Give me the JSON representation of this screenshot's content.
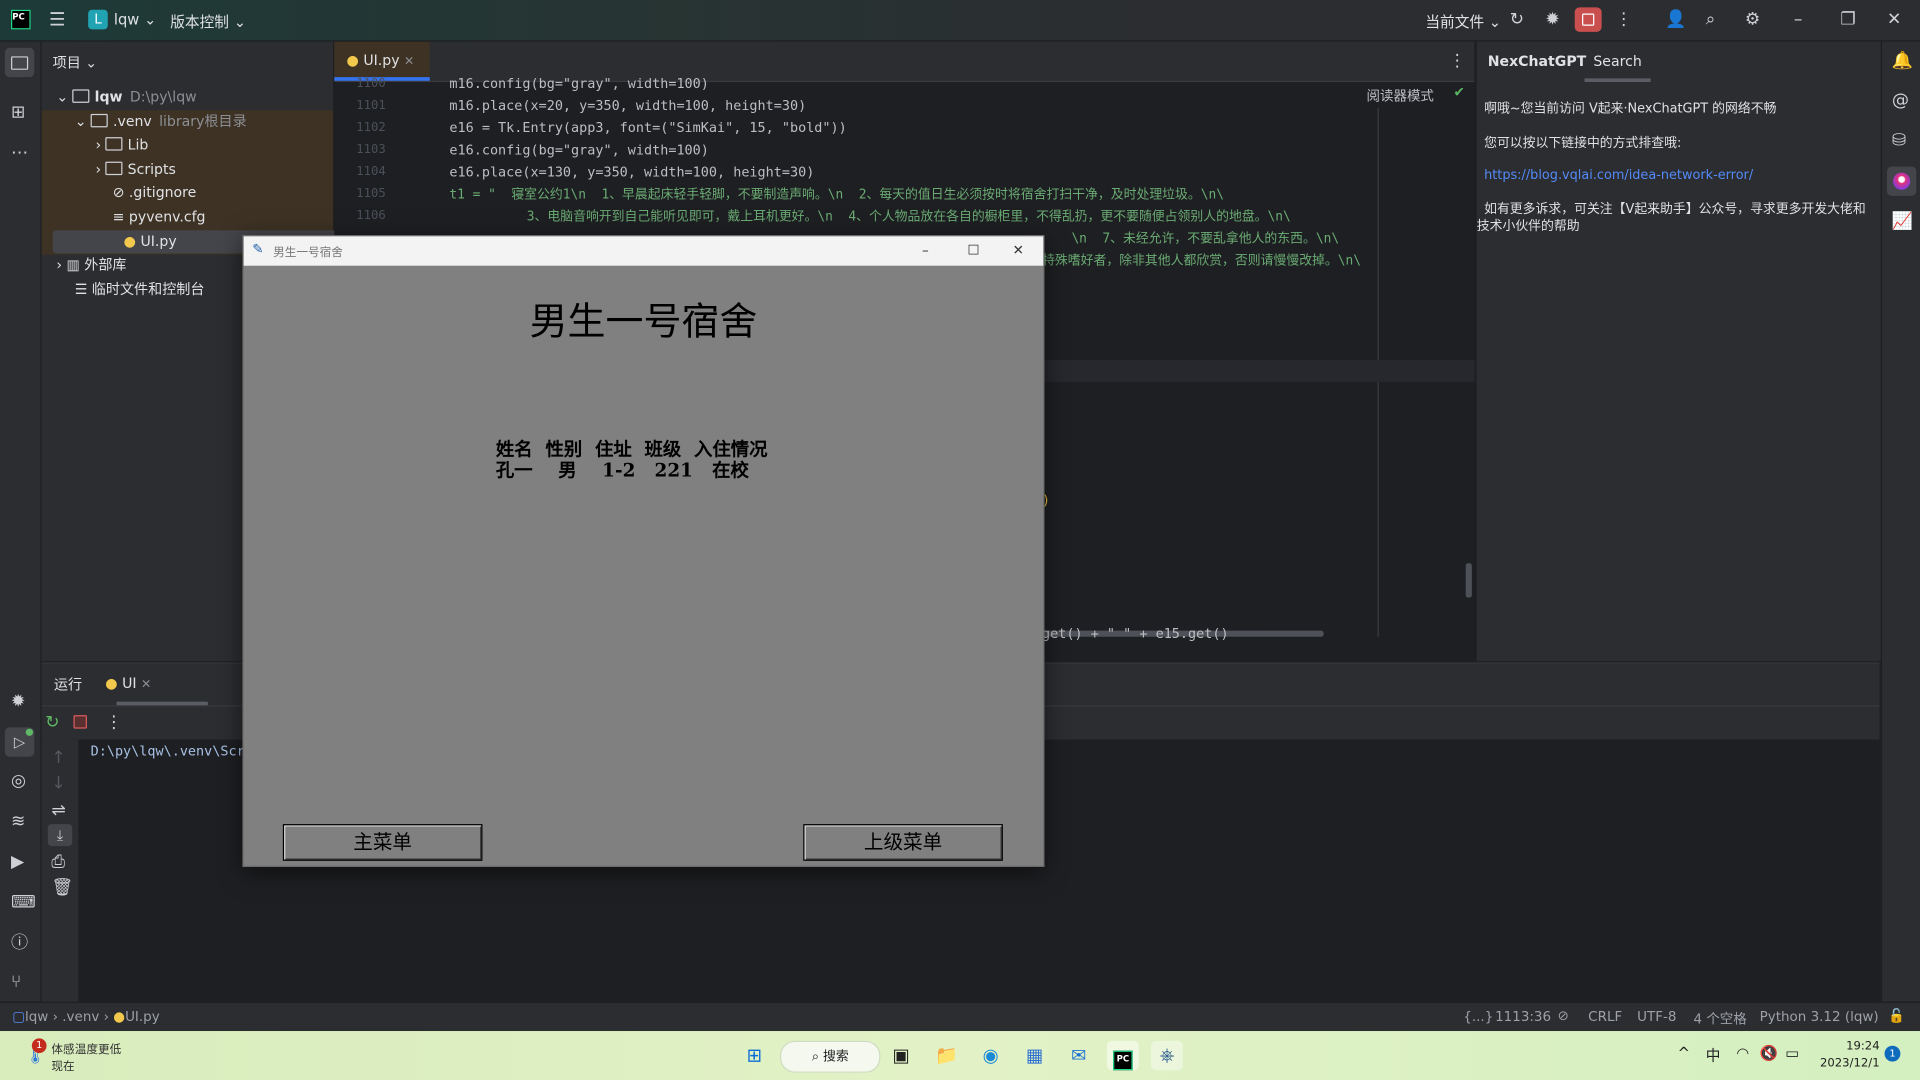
{
  "titlebar": {
    "project_badge": "L",
    "project": "lqw",
    "vcs": "版本控制",
    "run_config": "当前文件"
  },
  "project_panel": {
    "title": "项目",
    "tree": [
      {
        "name": "lqw",
        "hint": "D:\\py\\lqw"
      },
      {
        "name": ".venv",
        "hint": "library根目录"
      },
      {
        "name": "Lib"
      },
      {
        "name": "Scripts"
      },
      {
        "name": ".gitignore"
      },
      {
        "name": "pyvenv.cfg"
      },
      {
        "name": "UI.py"
      },
      {
        "name": "外部库"
      },
      {
        "name": "临时文件和控制台"
      }
    ]
  },
  "editor": {
    "tab": "UI.py",
    "reader_mode": "阅读器模式",
    "lines": [
      {
        "no": "1100",
        "code": "m16.config(bg=\"gray\", width=100)"
      },
      {
        "no": "1101",
        "code": "m16.place(x=20, y=350, width=100, height=30)"
      },
      {
        "no": "1102",
        "code": "e16 = Tk.Entry(app3, font=(\"SimKai\", 15, \"bold\"))"
      },
      {
        "no": "1103",
        "code": "e16.config(bg=\"gray\", width=100)"
      },
      {
        "no": "1104",
        "code": "e16.place(x=130, y=350, width=100, height=30)"
      },
      {
        "no": "1105",
        "code": "t1 = \"  寝室公约1\\n  1、早晨起床轻手轻脚，不要制造声响。\\n  2、每天的值日生必须按时将宿舍打扫干净，及时处理垃圾。\\n\\"
      },
      {
        "no": "1106",
        "code": "          3、电脑音响开到自己能听见即可，戴上耳机更好。\\n  4、个人物品放在各自的橱柜里，不得乱扔，更不要随便占领别人的地盘。\\n\\"
      }
    ],
    "partial_lines": [
      "\\n  7、未经允许，不要乱拿他人的东西。\\n\\",
      "特殊嗜好者，除非其他人都欣赏，否则请慢慢改掉。\\n\\"
    ],
    "bottom_fragment": "get() + \" \" + e15.get()"
  },
  "right_panel": {
    "tabs": [
      "NexChatGPT",
      "Search"
    ],
    "msg1": "啊哦~您当前访问 V起来·NexChatGPT 的网络不畅",
    "msg2": "您可以按以下链接中的方式排查哦:",
    "link": "https://blog.vqlai.com/idea-network-error/",
    "msg3": "如有更多诉求，可关注【V起来助手】公众号，寻求更多开发大佬和技术小伙伴的帮助"
  },
  "run_panel": {
    "label": "运行",
    "tab": "UI",
    "console": "D:\\py\\lqw\\.venv\\Scr"
  },
  "dialog": {
    "window_title": "男生一号宿舍",
    "heading": "男生一号宿舍",
    "table_header": "姓名  性别  住址  班级  入住情况",
    "table_row": "孔一    男    1-2   221   在校",
    "btn_main": "主菜单",
    "btn_up": "上级菜单"
  },
  "statusbar": {
    "breadcrumb": [
      "lqw",
      ".venv",
      "UI.py"
    ],
    "braces": "{...}",
    "position": "1113:36",
    "line_sep": "CRLF",
    "encoding": "UTF-8",
    "indent": "4 个空格",
    "interpreter": "Python 3.12 (lqw)"
  },
  "taskbar": {
    "weather_title": "体感温度更低",
    "weather_sub": "现在",
    "weather_badge": "1",
    "search": "搜索",
    "ime": "中",
    "time": "19:24",
    "date": "2023/12/1",
    "notif_badge": "1"
  },
  "colors": {
    "accent": "#3574f0",
    "string": "#6aab73",
    "keyword": "#c77d55",
    "number": "#2aacb8",
    "tk_gray": "#808080"
  }
}
